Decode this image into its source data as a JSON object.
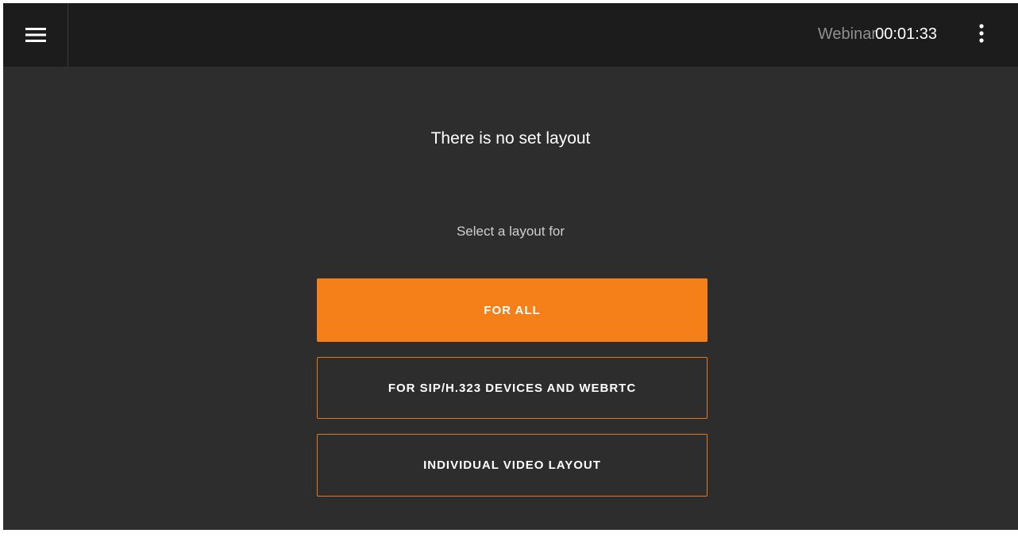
{
  "topbar": {
    "menu_icon": "hamburger-menu-icon",
    "session_type": "Webinar",
    "timer": "00:01:33",
    "more_icon": "more-vertical-icon"
  },
  "main": {
    "heading": "There is no set layout",
    "subheading": "Select a layout for",
    "buttons": {
      "for_all": "FOR ALL",
      "for_sip": "FOR SIP/H.323 DEVICES AND WEBRTC",
      "individual": "INDIVIDUAL VIDEO LAYOUT"
    }
  },
  "colors": {
    "accent": "#f58019",
    "background": "#2d2d2d",
    "topbar": "#1c1c1c"
  }
}
